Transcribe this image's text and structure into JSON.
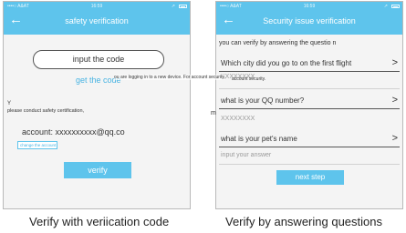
{
  "status_bar": {
    "carrier": "••••○ A&AT",
    "time": "16:59",
    "location": "↗"
  },
  "left_screen": {
    "title": "safety verification",
    "back_icon": "←",
    "code_input_placeholder": "input the code",
    "get_code_label": "get the code",
    "notice": "ou are logging in to a new device. For account security,",
    "y_letter": "Y",
    "conduct_text": "please conduct safety certification,",
    "account_text": "account: xxxxxxxxxx@qq.co",
    "change_account_label": "change the account",
    "verify_label": "verify"
  },
  "right_screen": {
    "title": "Security issue verification",
    "back_icon": "←",
    "intro": "you can verify by answering the questio n",
    "questions": [
      {
        "text": "Which city did you go to on the first flight",
        "answer": "XXXXXXXX"
      },
      {
        "text": "what is your QQ number?",
        "answer": "XXXXXXXX"
      },
      {
        "text": "what is your pet's name",
        "answer": "input your answer"
      }
    ],
    "chevron": ">",
    "next_label": "next step"
  },
  "overlay_text": {
    "m_letter": "m",
    "account_fragment": "account security."
  },
  "captions": {
    "left": "Verify with veriication code",
    "right": "Verify by answering questions"
  },
  "colors": {
    "accent": "#5ec4ec",
    "link": "#47b3e2",
    "background": "#f4f4f4"
  }
}
